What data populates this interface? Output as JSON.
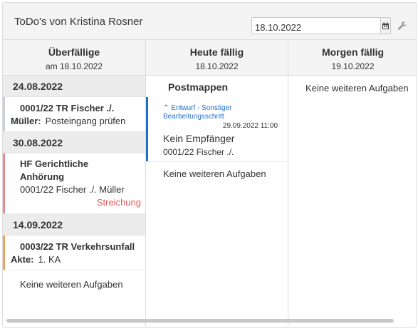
{
  "header": {
    "title": "ToDo's von Kristina Rosner",
    "date_value": "18.10.2022",
    "calendar_icon": "calendar-icon",
    "settings_icon": "wrench-icon"
  },
  "columns": {
    "overdue": {
      "title": "Überfällige",
      "date": "am 18.10.2022",
      "groups": [
        {
          "date": "24.08.2022",
          "title": "0001/22 TR Fischer ./.",
          "sub_label": "Müller:",
          "sub_value": "Posteingang prüfen",
          "right": "",
          "color": "#c9ced6"
        },
        {
          "date": "30.08.2022",
          "title": "HF Gerichtliche Anhörung",
          "sub_label": "",
          "sub_value": "0001/22 Fischer ./. Müller",
          "right": "Streichung",
          "color": "#f08a8a"
        },
        {
          "date": "14.09.2022",
          "title": "0003/22 TR Verkehrsunfall",
          "sub_label": "Akte:",
          "sub_value": "1. KA",
          "right": "",
          "color": "#f3a35a"
        }
      ],
      "no_more": "Keine weiteren Aufgaben"
    },
    "today": {
      "title": "Heute fällig",
      "date": "18.10.2022",
      "section": "Postmappen",
      "item": {
        "link": "Entwurf - Sonstiger Bearbeitungsschritt",
        "time": "29.09.2022 11:00",
        "name": "Kein Empfänger",
        "akte": "0001/22 Fischer ./."
      },
      "no_more": "Keine weiteren Aufgaben"
    },
    "tomorrow": {
      "title": "Morgen fällig",
      "date": "19.10.2022",
      "no_more": "Keine weiteren Aufgaben"
    }
  },
  "colors": {
    "accent": "#1e6fd0",
    "strike_red": "#e85a5a"
  }
}
